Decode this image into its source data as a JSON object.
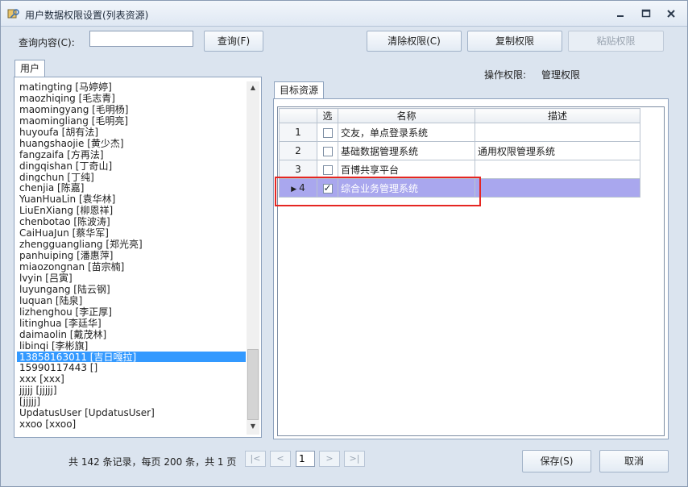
{
  "window": {
    "title": "用户数据权限设置(列表资源)"
  },
  "toolbar": {
    "query_label": "查询内容(C):",
    "query_value": "",
    "query_button": "查询(F)",
    "clear_button": "清除权限(C)",
    "copy_button": "复制权限",
    "paste_button": "粘贴权限"
  },
  "users_tab": {
    "label": "用户"
  },
  "permission": {
    "label": "操作权限:",
    "value": "管理权限"
  },
  "users": [
    "matingting [马婷婷]",
    "maozhiqing [毛志青]",
    "maomingyang [毛明杨]",
    "maomingliang [毛明亮]",
    "huyoufa [胡有法]",
    "huangshaojie [黄少杰]",
    "fangzaifa [方再法]",
    "dingqishan [丁奇山]",
    "dingchun [丁纯]",
    "chenjia [陈嘉]",
    "YuanHuaLin [袁华林]",
    "LiuEnXiang [柳恩祥]",
    "chenbotao [陈波涛]",
    "CaiHuaJun [蔡华军]",
    "zhengguangliang [郑光亮]",
    "panhuiping [潘惠萍]",
    "miaozongnan [苗宗楠]",
    "lvyin [吕寅]",
    "luyungang [陆云钢]",
    "luquan [陆泉]",
    "lizhenghou [李正厚]",
    "litinghua [李廷华]",
    "daimaolin [戴茂林]",
    "libinqi [李彬旗]",
    "13858163011 [吉日嘎拉]",
    "15990117443 []",
    "xxx [xxx]",
    "jjjjj [jjjjj]",
    " [jjjjj]",
    "UpdatusUser [UpdatusUser]",
    "xxoo [xxoo]"
  ],
  "selected_user_index": 24,
  "target_tab": {
    "label": "目标资源"
  },
  "grid": {
    "columns": [
      "选",
      "名称",
      "描述"
    ],
    "rows": [
      {
        "num": "1",
        "checked": false,
        "name": "交友，单点登录系统",
        "desc": ""
      },
      {
        "num": "2",
        "checked": false,
        "name": "基础数据管理系统",
        "desc": "通用权限管理系统"
      },
      {
        "num": "3",
        "checked": false,
        "name": "百博共享平台",
        "desc": ""
      },
      {
        "num": "4",
        "checked": true,
        "name": "综合业务管理系统",
        "desc": ""
      }
    ],
    "selected_row": 3
  },
  "pager": {
    "summary": "共 142 条记录，每页 200 条，共 1 页",
    "first": "|<",
    "prev": "<",
    "page": "1",
    "next": ">",
    "last": ">|"
  },
  "footer": {
    "save_button": "保存(S)",
    "cancel_button": "取消"
  },
  "colors": {
    "accent": "#3399ff",
    "row_selected": "#a9a7ee",
    "highlight": "#e52622"
  }
}
